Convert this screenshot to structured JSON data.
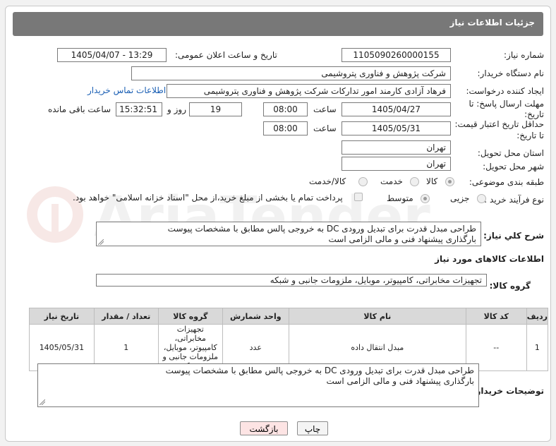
{
  "page": {
    "title": "جزئیات اطلاعات نیاز",
    "watermark": "AriaTender.neT"
  },
  "fields": {
    "need_number_label": "شماره نیاز:",
    "need_number": "1105090260000155",
    "announce_label": "تاریخ و ساعت اعلان عمومی:",
    "announce_value": "1405/04/07 - 13:29",
    "buyer_org_label": "نام دستگاه خریدار:",
    "buyer_org": "شرکت پژوهش و فناوری پتروشیمی",
    "requester_label": "ایجاد کننده درخواست:",
    "requester": "فرهاد آزادی کارمند امور تدارکات شرکت پژوهش و فناوری پتروشیمی",
    "contact_link": "اطلاعات تماس خریدار",
    "deadline_label_1": "مهلت ارسال پاسخ: تا",
    "deadline_label_2": "تاریخ:",
    "deadline_date": "1405/04/27",
    "hour_label": "ساعت",
    "deadline_time": "08:00",
    "days_value": "19",
    "day_and_label": "روز و",
    "remaining_time": "15:32:51",
    "remaining_label": "ساعت باقی مانده",
    "validity_label_1": "حداقل تاریخ اعتبار قیمت:",
    "validity_label_2": "تا تاریخ:",
    "validity_date": "1405/05/31",
    "validity_time": "08:00",
    "province_label": "استان محل تحویل:",
    "province": "تهران",
    "city_label": "شهر محل تحویل:",
    "city": "تهران",
    "category_label": "طبقه بندی موضوعی:",
    "category_options": [
      "کالا",
      "خدمت",
      "کالا/خدمت"
    ],
    "process_label": "نوع فرآیند خرید :",
    "process_options": [
      "جزیی",
      "متوسط"
    ],
    "payment_note": "پرداخت تمام یا بخشی از مبلغ خرید،از محل \"اسناد خزانه اسلامی\" خواهد بود.",
    "summary_label": "شرح کلي نياز:",
    "summary": "طراحی مبدل قدرت برای تبدیل ورودی DC به خروجی پالس مطابق با مشخصات پیوست\nبارگذاری پیشنهاد فنی و مالی الزامی است",
    "goods_info_title": "اطلاعات کالاهای مورد نياز",
    "goods_group_label": "گروه کالا:",
    "goods_group": "تجهیزات مخابراتی، کامپیوتر، موبایل، ملزومات جانبی و شبکه",
    "buyer_desc_label": "توضیحات خریدار:",
    "buyer_desc": "طراحی مبدل قدرت برای تبدیل ورودی DC به خروجی پالس مطابق با مشخصات پیوست\nبارگذاری پیشنهاد فنی و مالی الزامی است"
  },
  "table": {
    "headers": [
      "ردیف",
      "کد کالا",
      "نام کالا",
      "واحد شمارش",
      "گروه کالا",
      "تعداد / مقدار",
      "تاریخ نیاز"
    ],
    "rows": [
      [
        "1",
        "--",
        "مبدل انتقال داده",
        "عدد",
        "تجهیزات مخابراتی، کامپیوتر، موبایل، ملزومات جانبی و شبکه",
        "1",
        "1405/05/31"
      ]
    ]
  },
  "buttons": {
    "print": "چاپ",
    "back": "بازگشت"
  },
  "colors": {
    "header_bg": "#787878",
    "link": "#1a5fb4",
    "back_button_bg": "#fde4e4"
  }
}
